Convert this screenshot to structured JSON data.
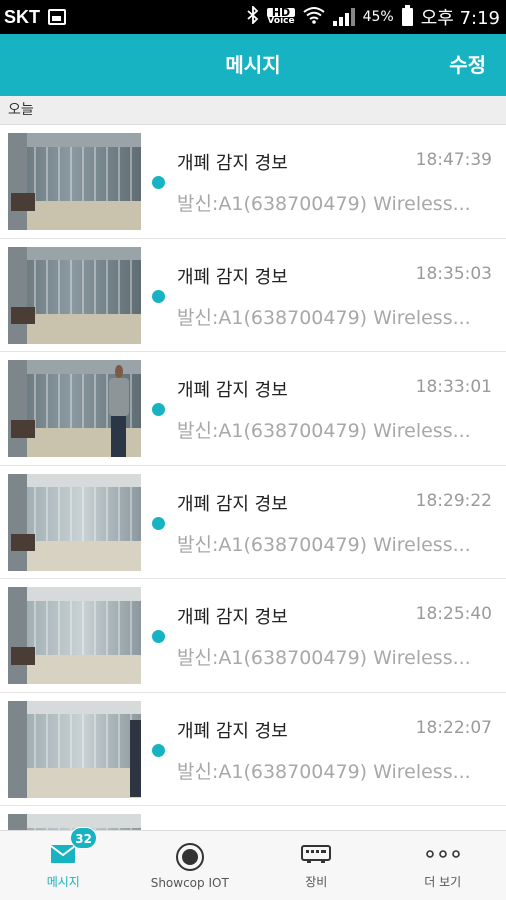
{
  "status_bar": {
    "carrier": "SKT",
    "hd_label": "HD",
    "voice_label": "Voice",
    "battery": "45%",
    "time": "오후 7:19"
  },
  "header": {
    "title": "메시지",
    "edit_label": "수정"
  },
  "section": {
    "label": "오늘"
  },
  "messages": [
    {
      "title": "개폐 감지 경보",
      "time": "18:47:39",
      "subtitle": "발신:A1(638700479) Wireless..."
    },
    {
      "title": "개폐 감지 경보",
      "time": "18:35:03",
      "subtitle": "발신:A1(638700479) Wireless..."
    },
    {
      "title": "개폐 감지 경보",
      "time": "18:33:01",
      "subtitle": "발신:A1(638700479) Wireless..."
    },
    {
      "title": "개폐 감지 경보",
      "time": "18:29:22",
      "subtitle": "발신:A1(638700479) Wireless..."
    },
    {
      "title": "개폐 감지 경보",
      "time": "18:25:40",
      "subtitle": "발신:A1(638700479) Wireless..."
    },
    {
      "title": "개폐 감지 경보",
      "time": "18:22:07",
      "subtitle": "발신:A1(638700479) Wireless..."
    }
  ],
  "tabs": [
    {
      "label": "메시지",
      "icon": "mail-icon",
      "badge": "32",
      "active": true
    },
    {
      "label": "Showcop IOT",
      "icon": "record-icon"
    },
    {
      "label": "장비",
      "icon": "device-icon"
    },
    {
      "label": "더 보기",
      "icon": "more-icon"
    }
  ],
  "colors": {
    "accent": "#17b3c2",
    "status_bar": "#000000"
  }
}
